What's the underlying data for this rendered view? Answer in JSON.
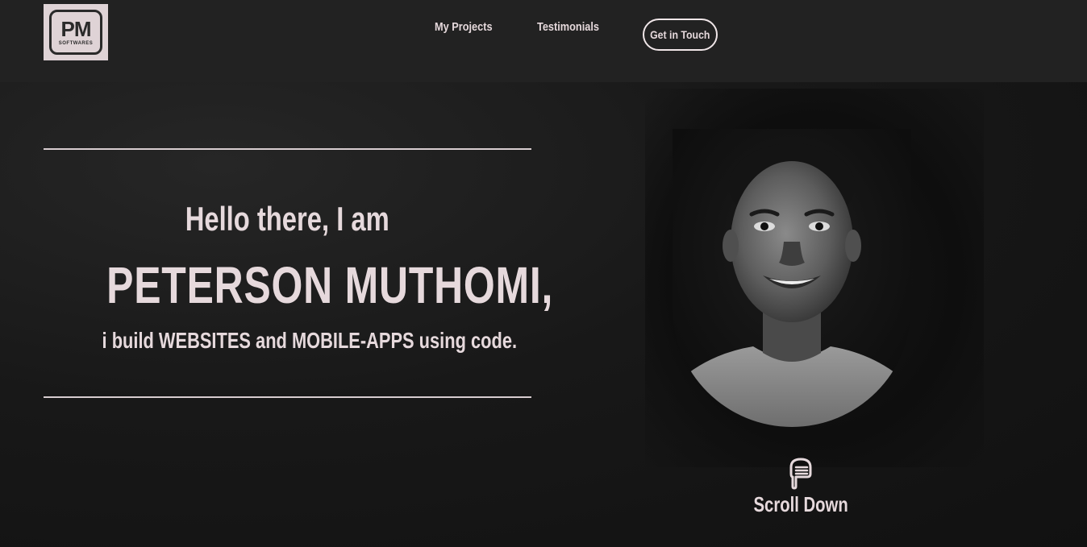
{
  "brand": {
    "logo_mark": "PM",
    "logo_sub": "SOFTWARES"
  },
  "nav": {
    "items": [
      {
        "label": "My Projects"
      },
      {
        "label": "Testimonials"
      }
    ],
    "cta_label": "Get in Touch"
  },
  "hero": {
    "greeting": "Hello there, I am",
    "name": "PETERSON MUTHOMI,",
    "tagline": "i build WEBSITES and MOBILE-APPS using code."
  },
  "scroll": {
    "label": "Scroll Down",
    "icon": "pointing-down-hand-icon"
  },
  "colors": {
    "background": "#121212",
    "header": "#222222",
    "text": "#e6d9dc",
    "logo_bg": "#dfd3d6"
  }
}
